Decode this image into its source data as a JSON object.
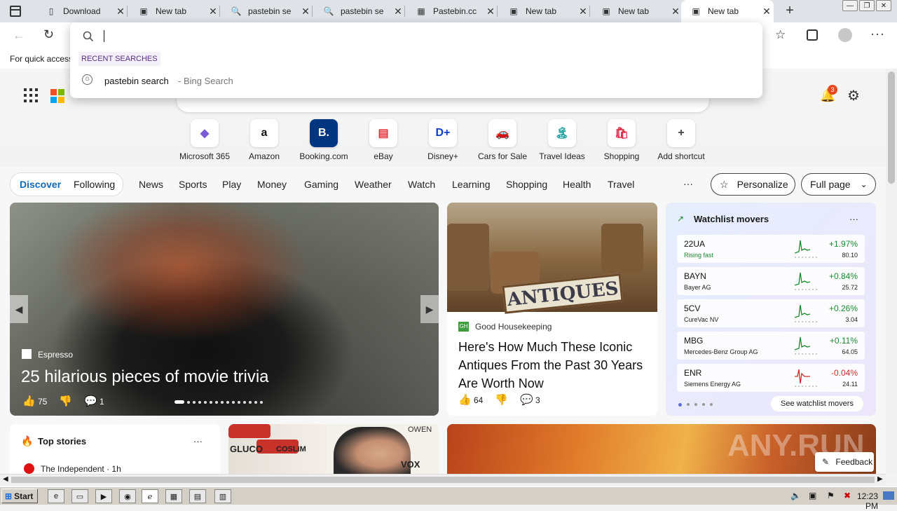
{
  "tabs": [
    {
      "title": "Download",
      "icon": "page-icon"
    },
    {
      "title": "New tab",
      "icon": "newtab-icon"
    },
    {
      "title": "pastebin se",
      "icon": "search-icon"
    },
    {
      "title": "pastebin se",
      "icon": "search-icon"
    },
    {
      "title": "Pastebin.cc",
      "icon": "pastebin-icon"
    },
    {
      "title": "New tab",
      "icon": "newtab-icon"
    },
    {
      "title": "New tab",
      "icon": "newtab-icon"
    },
    {
      "title": "New tab",
      "icon": "newtab-icon",
      "active": true
    }
  ],
  "favbar": {
    "text": "For quick access"
  },
  "omnibox": {
    "recent_header": "RECENT SEARCHES",
    "suggestion": "pastebin search",
    "suggestion_source": "- Bing Search"
  },
  "notifications": {
    "count": "3"
  },
  "shortcuts": [
    {
      "label": "Microsoft 365",
      "icon": "microsoft365-icon",
      "glyph": "◆",
      "color": "#7b5cd6"
    },
    {
      "label": "Amazon",
      "icon": "amazon-icon",
      "glyph": "a",
      "color": "#111111"
    },
    {
      "label": "Booking.com",
      "icon": "booking-icon",
      "glyph": "B.",
      "color": "#ffffff"
    },
    {
      "label": "eBay",
      "icon": "ebay-icon",
      "glyph": "▤",
      "color": "#e53238"
    },
    {
      "label": "Disney+",
      "icon": "disney-icon",
      "glyph": "D+",
      "color": "#113ccf"
    },
    {
      "label": "Cars for Sale",
      "icon": "car-icon",
      "glyph": "🚗",
      "color": "#1f6fd8"
    },
    {
      "label": "Travel Ideas",
      "icon": "travel-icon",
      "glyph": "🏝",
      "color": "#20a0a0"
    },
    {
      "label": "Shopping",
      "icon": "shopping-icon",
      "glyph": "🛍",
      "color": "#e0314b"
    },
    {
      "label": "Add shortcut",
      "icon": "plus-icon",
      "glyph": "+",
      "color": "#444444"
    }
  ],
  "feed_nav": {
    "discover": "Discover",
    "following": "Following",
    "items": [
      "News",
      "Sports",
      "Play",
      "Money",
      "Gaming",
      "Weather",
      "Watch",
      "Learning",
      "Shopping",
      "Health",
      "Travel"
    ],
    "more": "···",
    "personalize": "Personalize",
    "full_page": "Full page"
  },
  "hero": {
    "source": "Espresso",
    "title": "25 hilarious pieces of movie trivia",
    "likes": "75",
    "comments": "1"
  },
  "article2": {
    "source": "Good Housekeeping",
    "title": "Here's How Much These Iconic Antiques From the Past 30 Years Are Worth Now",
    "likes": "64",
    "comments": "3",
    "sign_text": "ANTIQUES"
  },
  "watchlist": {
    "title": "Watchlist movers",
    "more": "···",
    "link": "See watchlist movers",
    "stocks": [
      {
        "symbol": "22UA",
        "name": "Rising fast",
        "pct": "+1.97%",
        "price": "80.10",
        "color": "#1a8a2e"
      },
      {
        "symbol": "BAYN",
        "name": "Bayer AG",
        "pct": "+0.84%",
        "price": "25.72",
        "color": "#1a8a2e"
      },
      {
        "symbol": "5CV",
        "name": "CureVac NV",
        "pct": "+0.26%",
        "price": "3.04",
        "color": "#1a8a2e"
      },
      {
        "symbol": "MBG",
        "name": "Mercedes-Benz Group AG",
        "pct": "+0.11%",
        "price": "64.05",
        "color": "#1a8a2e"
      },
      {
        "symbol": "ENR",
        "name": "Siemens Energy AG",
        "pct": "-0.04%",
        "price": "24.11",
        "color": "#d12b2b"
      }
    ]
  },
  "top_stories": {
    "title": "Top stories",
    "more": "···",
    "first_source": "The Independent · 1h"
  },
  "bottom_ad": {
    "brand1": "GLUCO",
    "brand2": "COSLIM",
    "brand3": "VOX",
    "brand4": "OWEN"
  },
  "feedback": "Feedback",
  "watermark": "ANY.RUN",
  "taskbar": {
    "start": "Start",
    "clock": "12:23 PM"
  }
}
